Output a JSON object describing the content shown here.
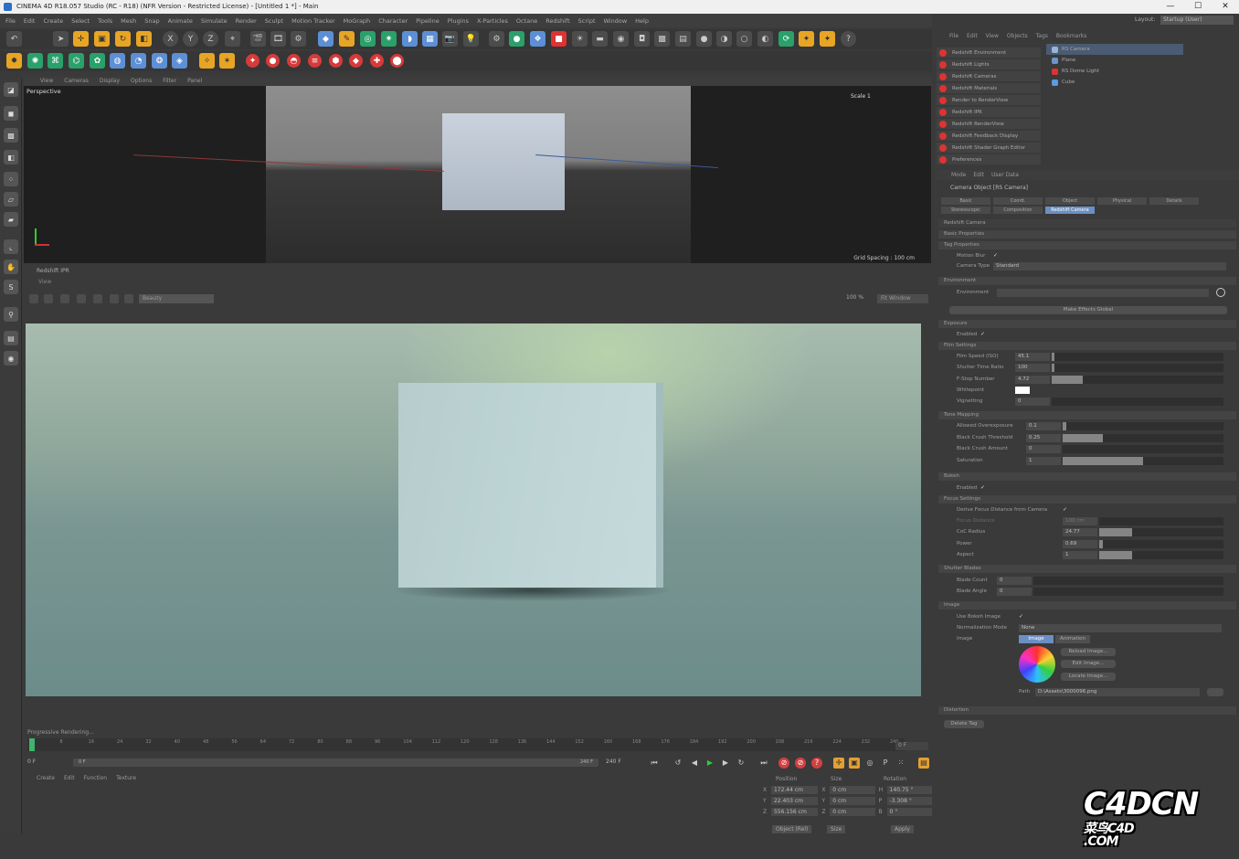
{
  "window": {
    "title": "CINEMA 4D R18.057 Studio (RC - R18) (NFR Version - Restricted License) - [Untitled 1 *] - Main",
    "controls": [
      "—",
      "☐",
      "✕"
    ]
  },
  "menubar": [
    "File",
    "Edit",
    "Create",
    "Select",
    "Tools",
    "Mesh",
    "Snap",
    "Animate",
    "Simulate",
    "Render",
    "Sculpt",
    "Motion Tracker",
    "MoGraph",
    "Character",
    "Pipeline",
    "Plugins",
    "X-Particles",
    "Octane",
    "Redshift",
    "Script",
    "Window",
    "Help"
  ],
  "layout": {
    "label": "Layout:",
    "value": "Startup (User)"
  },
  "viewport": {
    "menu": [
      "View",
      "Cameras",
      "Display",
      "Options",
      "Filter",
      "Panel"
    ],
    "label": "Perspective",
    "scale": "Scale 1",
    "grid_spacing": "Grid Spacing : 100 cm"
  },
  "ipr": {
    "title": "Redshift IPR",
    "menu": "View",
    "aov": "Beauty",
    "zoom": "100 %",
    "fit": "Fit Window",
    "status": "Progressive Rendering..."
  },
  "timeline": {
    "ticks": [
      "0",
      "8",
      "16",
      "24",
      "32",
      "40",
      "48",
      "56",
      "64",
      "72",
      "80",
      "88",
      "96",
      "104",
      "112",
      "120",
      "128",
      "136",
      "144",
      "152",
      "160",
      "168",
      "176",
      "184",
      "192",
      "200",
      "208",
      "216",
      "224",
      "232",
      "240"
    ],
    "current": "0 F",
    "start": "0 F",
    "start2": "0 F",
    "end": "240 F",
    "end2": "240 F"
  },
  "material_manager": [
    "Create",
    "Edit",
    "Function",
    "Texture"
  ],
  "coordinates": {
    "headers": [
      "Position",
      "Size",
      "Rotation"
    ],
    "rows": [
      {
        "axis": "X",
        "pos": "172.44 cm",
        "saxis": "X",
        "size": "0 cm",
        "raxis": "H",
        "rot": "140.75 °"
      },
      {
        "axis": "Y",
        "pos": "22.403 cm",
        "saxis": "Y",
        "size": "0 cm",
        "raxis": "P",
        "rot": "-3.308 °"
      },
      {
        "axis": "Z",
        "pos": "556.156 cm",
        "saxis": "Z",
        "size": "0 cm",
        "raxis": "B",
        "rot": "0 °"
      }
    ],
    "mode": "Object (Rel)",
    "size_mode": "Size",
    "apply": "Apply"
  },
  "object_manager": {
    "menu": [
      "File",
      "Edit",
      "View",
      "Objects",
      "Tags",
      "Bookmarks"
    ],
    "objects": [
      "RS Camera",
      "Plane",
      "RS Dome Light",
      "Cube"
    ]
  },
  "redshift_menu": [
    "Redshift Environment",
    "Redshift Lights",
    "Redshift Cameras",
    "Redshift Materials",
    "Render to RenderView",
    "Redshift IPR",
    "Redshift RenderView",
    "Redshift Feedback Display",
    "Redshift Shader Graph Editor",
    "Preferences"
  ],
  "attributes": {
    "menu": [
      "Mode",
      "Edit",
      "User Data"
    ],
    "title": "Camera Object [RS Camera]",
    "tabs": [
      "Basic",
      "Coord.",
      "Object",
      "Physical",
      "Details",
      "Stereoscopic",
      "Composition",
      "Redshift Camera"
    ],
    "section": "Redshift Camera",
    "basic_properties": "Basic Properties",
    "tag_properties": "Tag Properties",
    "motion_blur": "Motion Blur",
    "camera_type_label": "Camera Type",
    "camera_type": "Standard",
    "environment_section": "Environment",
    "environment": "Environment",
    "make_global": "Make Effects Global",
    "exposure": "Exposure",
    "enabled": "Enabled",
    "film_settings": "Film Settings",
    "film_speed_label": "Film Speed (ISO)",
    "film_speed": "45.1",
    "shutter_label": "Shutter Time Ratio",
    "shutter": "100",
    "fstop_label": "F-Stop Number",
    "fstop": "4.72",
    "whitepoint": "Whitepoint",
    "vignetting_label": "Vignetting",
    "vignetting": "0",
    "tone_mapping": "Tone Mapping",
    "overexposure_label": "Allowed Overexposure",
    "overexposure": "0.1",
    "crush_threshold_label": "Black Crush Threshold",
    "crush_threshold": "0.25",
    "crush_amount_label": "Black Crush Amount",
    "crush_amount": "0",
    "saturation_label": "Saturation",
    "saturation": "1",
    "bokeh": "Bokeh",
    "bokeh_enabled": "Enabled",
    "focus_settings": "Focus Settings",
    "derive_focus": "Derive Focus Distance from Camera",
    "focus_distance_label": "Focus Distance",
    "focus_distance": "100 cm",
    "coc_label": "CoC Radius",
    "coc": "24.77",
    "power_label": "Power",
    "power": "0.69",
    "aspect_label": "Aspect",
    "aspect": "1",
    "shutter_blades": "Shutter Blades",
    "blade_count_label": "Blade Count",
    "blade_count": "0",
    "blade_angle_label": "Blade Angle",
    "blade_angle": "0",
    "image_section": "Image",
    "use_bokeh_label": "Use Bokeh Image",
    "normalization_label": "Normalization Mode",
    "normalization": "None",
    "image_label": "Image",
    "image_tab": "Image",
    "anim_tab": "Animation",
    "reload": "Reload Image...",
    "edit": "Edit Image...",
    "locate": "Locate Image...",
    "path_label": "Path",
    "path": "D:\\Assets\\3000096.png",
    "distortion": "Distortion",
    "delete_tag": "Delete Tag"
  },
  "watermark": {
    "main": "C4DCN",
    "sub1": "菜鸟C4D",
    "sub2": ".COM"
  }
}
